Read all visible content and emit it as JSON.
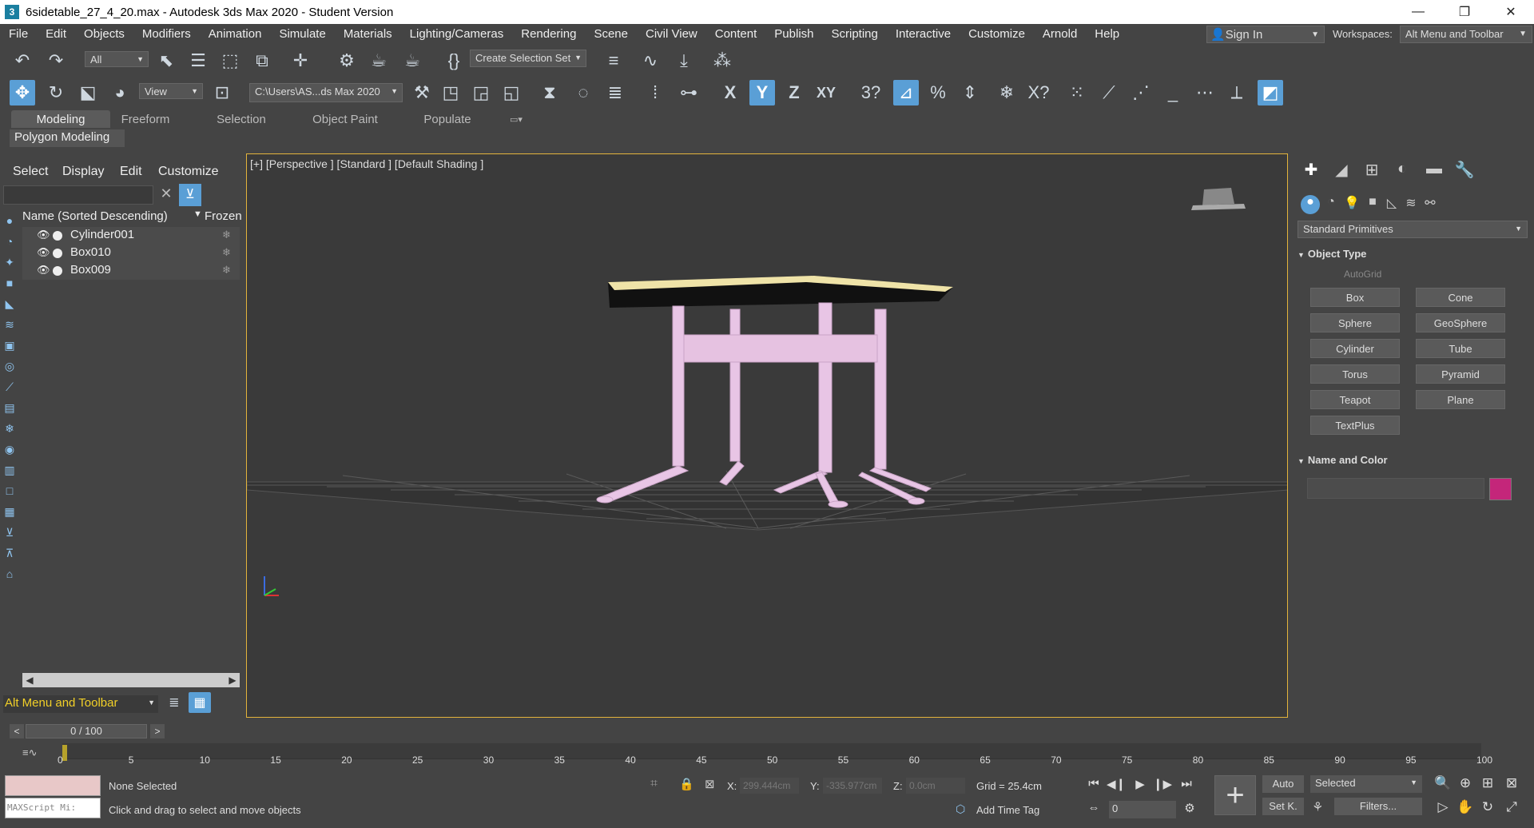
{
  "window": {
    "title": "6sidetable_27_4_20.max - Autodesk 3ds Max 2020 - Student Version",
    "app_icon": "3",
    "controls": [
      "—",
      "❐",
      "✕"
    ]
  },
  "menu": {
    "items": [
      "File",
      "Edit",
      "Objects",
      "Modifiers",
      "Animation",
      "Simulate",
      "Materials",
      "Lighting/Cameras",
      "Rendering",
      "Scene",
      "Civil View",
      "Content",
      "Publish",
      "Scripting",
      "Interactive",
      "Customize",
      "Arnold",
      "Help"
    ],
    "sign_in": "Sign In",
    "workspaces_label": "Workspaces:",
    "workspace_value": "Alt Menu and Toolbar"
  },
  "toolbar": {
    "filter_value": "All",
    "selection_set_label": "Create Selection Set",
    "ref_coord_value": "View",
    "project_path": "C:\\Users\\AS...ds Max 2020",
    "axis_x": "X",
    "axis_y": "Y",
    "axis_z": "Z",
    "axis_xy": "XY"
  },
  "ribbon": {
    "tabs": [
      "Modeling",
      "Freeform",
      "Selection",
      "Object Paint",
      "Populate"
    ],
    "active_tab": "Modeling",
    "panel_label": "Polygon Modeling"
  },
  "explorer": {
    "menu": [
      "Select",
      "Display",
      "Edit",
      "Customize"
    ],
    "column_name": "Name (Sorted Descending)",
    "column_frozen": "Frozen",
    "rows": [
      {
        "name": "Cylinder001"
      },
      {
        "name": "Box010"
      },
      {
        "name": "Box009"
      }
    ],
    "workspace": "Alt Menu and Toolbar"
  },
  "viewport": {
    "label": "[+] [Perspective ] [Standard ] [Default Shading ]",
    "colors": {
      "tabletop": "#efe3a8",
      "legs": "#e8c5e5",
      "border": "#e3b43c",
      "background": "#3a3a3a"
    }
  },
  "command_panel": {
    "primitives_dropdown": "Standard Primitives",
    "object_type_title": "Object Type",
    "autogrid": "AutoGrid",
    "buttons": [
      "Box",
      "Cone",
      "Sphere",
      "GeoSphere",
      "Cylinder",
      "Tube",
      "Torus",
      "Pyramid",
      "Teapot",
      "Plane",
      "TextPlus"
    ],
    "name_color_title": "Name and Color",
    "color": "#c4267a"
  },
  "timeline": {
    "frame_display": "0 / 100",
    "ticks": [
      "0",
      "5",
      "10",
      "15",
      "20",
      "25",
      "30",
      "35",
      "40",
      "45",
      "50",
      "55",
      "60",
      "65",
      "70",
      "75",
      "80",
      "85",
      "90",
      "95",
      "100"
    ]
  },
  "status": {
    "maxscript_placeholder": "MAXScript Mi:",
    "selection_status": "None Selected",
    "prompt": "Click and drag to select and move objects",
    "x_label": "X:",
    "x_value": "299.444cm",
    "y_label": "Y:",
    "y_value": "-335.977cm",
    "z_label": "Z:",
    "z_value": "0.0cm",
    "grid": "Grid = 25.4cm",
    "add_time_tag": "Add Time Tag",
    "current_frame": "0",
    "auto_label": "Auto",
    "setk_label": "Set K.",
    "selected_label": "Selected",
    "filters_label": "Filters..."
  }
}
